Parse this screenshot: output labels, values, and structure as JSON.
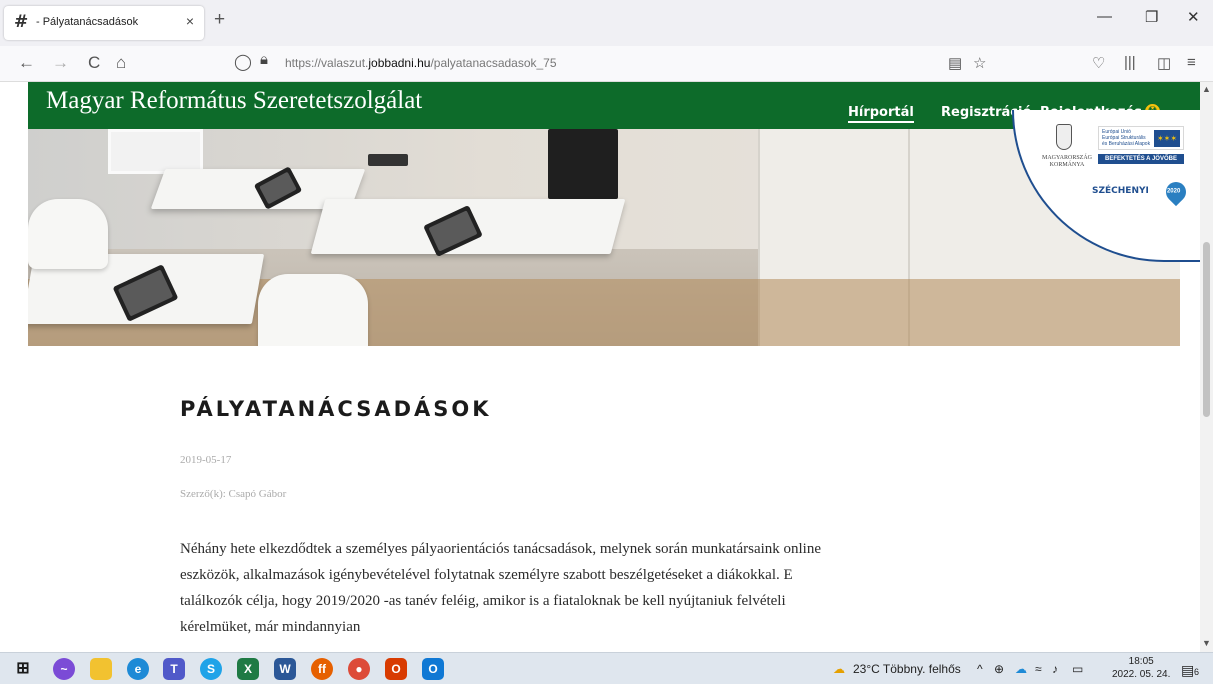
{
  "browser": {
    "tab_favicon": "#",
    "tab_title": "- Pályatanácsadások",
    "tab_close": "×",
    "new_tab": "+",
    "window_controls": {
      "minimize": "—",
      "restore": "❐",
      "close": "✕"
    },
    "nav": {
      "back": "←",
      "forward": "→",
      "reload": "C",
      "home": "⌂"
    },
    "url_prefix": "https://valaszut.",
    "url_domain": "jobbadni.hu",
    "url_path": "/palyatanacsadasok_75"
  },
  "site": {
    "title": "Magyar Református Szeretetszolgálat",
    "nav": [
      "Hírportál",
      "Regisztráció",
      "Bejelentkezés"
    ],
    "nav_badge": "☢",
    "badge": {
      "gov": "MAGYARORSZÁG\nKORMÁNYA",
      "eu": "Európai Unió\nEurópai Strukturális\nés Beruházási Alapok",
      "invest": "BEFEKTETÉS A JÖVŐBE",
      "szechenyi": "SZÉCHENYI",
      "year": "2020"
    }
  },
  "article": {
    "title": "PÁLYATANÁCSADÁSOK",
    "date": "2019-05-17",
    "author": "Szerző(k): Csapó Gábor",
    "body": " Néhány hete elkezdődtek a személyes pályaorientációs tanácsadások, melynek során munkatársaink online eszközök, alkalmazások igénybevételével folytatnak személyre szabott beszélgetéseket a diákokkal. E találkozók célja, hogy 2019/2020 -as tanév feléig, amikor is a fiataloknak be kell nyújtaniuk felvételi kérelmüket, már mindannyian"
  },
  "taskbar": {
    "weather": "23°C  Többny. felhős",
    "time": "18:05",
    "date": "2022. 05. 24.",
    "notif_count": "6"
  },
  "colors": {
    "site_green": "#0d6b2a",
    "eu_blue": "#1f4e8f"
  }
}
